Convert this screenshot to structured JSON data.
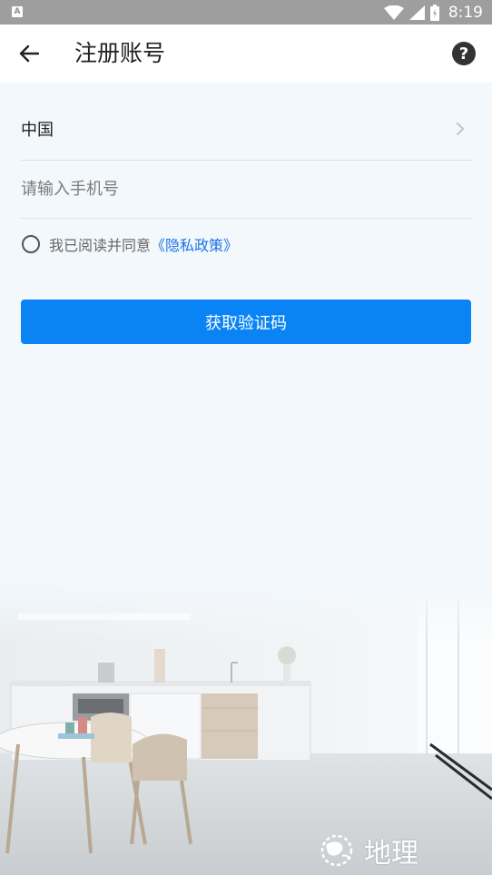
{
  "status_bar": {
    "indicator": "A",
    "time": "8:19",
    "icons": [
      "wifi-icon",
      "cell-signal-icon",
      "battery-icon"
    ]
  },
  "app_bar": {
    "title": "注册账号",
    "back_icon": "back-arrow-icon",
    "help_label": "?"
  },
  "form": {
    "country": "中国",
    "phone_placeholder": "请输入手机号",
    "phone_value": "",
    "agree_text": "我已阅读并同意",
    "policy_link": "《隐私政策》",
    "agree_checked": false,
    "submit_label": "获取验证码"
  },
  "watermark": {
    "text": "地理"
  },
  "colors": {
    "accent": "#0a84f5",
    "link": "#1a73e8",
    "background": "#f3f8fc",
    "status_bar": "#9e9e9e"
  }
}
